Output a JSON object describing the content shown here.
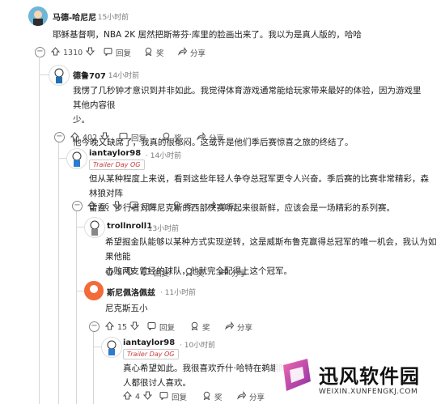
{
  "comments": [
    {
      "username": "马德-哈尼尼",
      "time": "15小时前",
      "body_lines": [
        "耶稣基督啊，NBA 2K 居然把斯蒂芬·库里的脸画出来了。我以为是真人版的，哈哈"
      ],
      "votes": "1310",
      "reply": "回复",
      "award": "奖",
      "share": "分享"
    },
    {
      "username": "德鲁707",
      "time": "14小时前",
      "body_lines": [
        "我愣了几秒钟才意识到并非如此。我觉得体育游戏通常能给玩家带来最好的体验，因为游戏里其他内容很",
        "少。",
        "",
        "他今晚又缺席了，我真的很郁闷。这或许是他们季后赛惊喜之旅的终结了。"
      ],
      "votes": "402",
      "reply": "回复",
      "award": "奖",
      "share": "分享"
    },
    {
      "username": "iantaylor98",
      "time": "14小时前",
      "flair": "Trailer Day OG",
      "body_lines": [
        "但从某种程度上来说，看到这些年轻人争夺总冠军更令人兴奋。季后赛的比赛非常精彩，森林狼对阵",
        "雷霆、步行者对阵尼克斯的西部决赛听起来很新鲜，应该会是一场精彩的系列赛。"
      ],
      "votes": "66",
      "reply": "回复",
      "award": "奖",
      "share": "分享"
    },
    {
      "username": "trollnroll1",
      "time": "13小时前",
      "body_lines": [
        "希望掘金队能够以某种方式实现逆转，这是威斯布鲁克赢得总冠军的唯一机会，我认为如果他能",
        "击败两支曾经的球队，他就完全配得上这个冠军。"
      ],
      "votes": "8",
      "reply": "回复",
      "award": "奖",
      "share": "分享"
    },
    {
      "username": "斯尼佩洛佩兹",
      "time": "11小时前",
      "body_lines": [
        "尼克斯五小"
      ],
      "votes": "15",
      "reply": "回复",
      "award": "奖",
      "share": "分享"
    },
    {
      "username": "iantaylor98",
      "time": "10小时前",
      "flair": "Trailer Day OG",
      "body_lines": [
        "真心希望如此。我很喜欢乔什·哈特在鹈鹕队的",
        "人都很讨人喜欢。"
      ],
      "votes": "4",
      "reply": "回复",
      "award": "奖",
      "share": "分享"
    }
  ],
  "watermark": {
    "name": "迅风软件园",
    "url": "WEIXIN.XUNFENGKJ.COM",
    "accent": "#c5338f"
  }
}
